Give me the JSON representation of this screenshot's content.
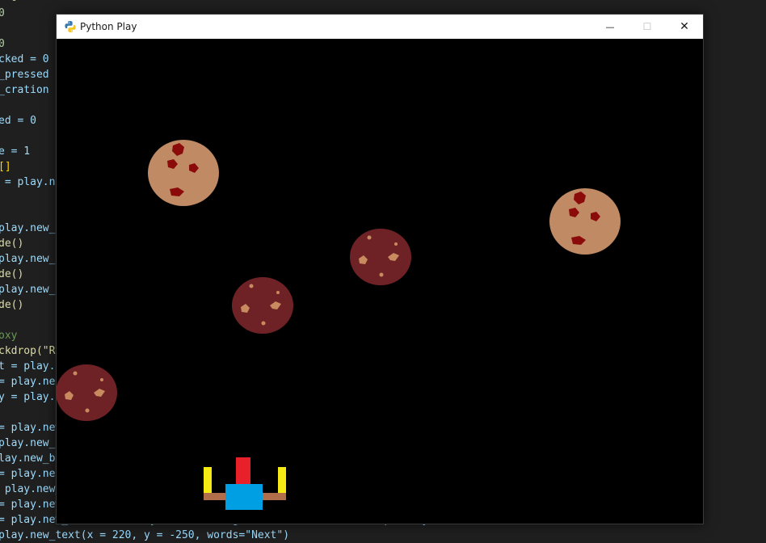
{
  "window": {
    "title": "Python Play",
    "buttons": {
      "minimize": "—",
      "maximize": "☐",
      "close": "✕"
    }
  },
  "editor": {
    "lines": [
      {
        "text": "= 0",
        "kind": "num"
      },
      {
        "text": "0",
        "kind": "num"
      },
      {
        "text": "",
        "kind": "op"
      },
      {
        "text": "0",
        "kind": "num"
      },
      {
        "text": "cked = 0",
        "kind": "var"
      },
      {
        "text": "_pressed =",
        "kind": "var"
      },
      {
        "text": "_cration =",
        "kind": "var"
      },
      {
        "text": "",
        "kind": "op"
      },
      {
        "text": "ed = 0",
        "kind": "var"
      },
      {
        "text": "",
        "kind": "op"
      },
      {
        "text": "e = 1",
        "kind": "var"
      },
      {
        "text": "[]",
        "kind": "brk"
      },
      {
        "text": " = play.ne",
        "kind": "var"
      },
      {
        "text": "",
        "kind": "op"
      },
      {
        "text": "",
        "kind": "op"
      },
      {
        "text": "play.new_i",
        "kind": "var"
      },
      {
        "text": "de()",
        "kind": "fn"
      },
      {
        "text": "play.new_i",
        "kind": "var"
      },
      {
        "text": "de()",
        "kind": "fn"
      },
      {
        "text": "play.new_i",
        "kind": "var"
      },
      {
        "text": "de()",
        "kind": "fn"
      },
      {
        "text": "",
        "kind": "op"
      },
      {
        "text": "oxy",
        "kind": "cmt"
      },
      {
        "text": "ckdrop(\"Re",
        "kind": "fn"
      },
      {
        "text": "t = play.n",
        "kind": "var"
      },
      {
        "text": "= play.ne",
        "kind": "var"
      },
      {
        "text": "y = play.n",
        "kind": "var"
      },
      {
        "text": "",
        "kind": "op"
      },
      {
        "text": "= play.new",
        "kind": "var"
      },
      {
        "text": "play.new_b",
        "kind": "var"
      },
      {
        "text": "lay.new_bo",
        "kind": "var"
      },
      {
        "text": "= play.ne",
        "kind": "var"
      },
      {
        "text": " play.new_",
        "kind": "var"
      },
      {
        "text": "= play.new_t",
        "kind": "var"
      },
      {
        "text": "= play.new_box(x = 220, y = -250, height=80, width=180, transparency=20, color=\"white\")",
        "kind": "var"
      },
      {
        "text": "play.new_text(x = 220, y = -250, words=\"Next\")",
        "kind": "var"
      }
    ]
  },
  "game": {
    "background": "#000000",
    "big_cookie_color": "#bf8a64",
    "chip_color": "#8b0a0a",
    "small_cookie_color": "#6f2226",
    "small_chip_color": "#c88a5f",
    "ship_base_color": "#009fe3",
    "ship_cannon_color": "#e8202a",
    "ship_side_color": "#f5ea14",
    "ship_wing_color": "#b06e4a"
  }
}
